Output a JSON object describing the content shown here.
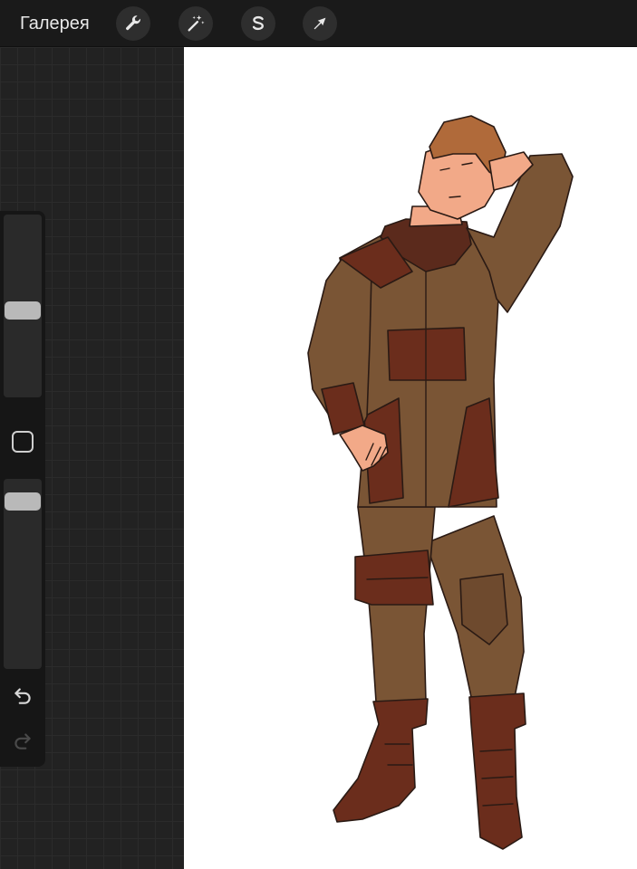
{
  "topbar": {
    "gallery_label": "Галерея",
    "tools": [
      {
        "name": "wrench-icon",
        "action": "actions"
      },
      {
        "name": "magic-wand-icon",
        "action": "adjustments"
      },
      {
        "name": "selection-s-icon",
        "action": "selection"
      },
      {
        "name": "arrow-cursor-icon",
        "action": "transform"
      }
    ]
  },
  "sidebar": {
    "brush_size_level": 0.47,
    "opacity_level": 0.94,
    "modify_button": "square-icon",
    "undo": "undo-icon",
    "redo": "redo-icon",
    "redo_enabled": false
  },
  "canvas": {
    "content": "character-illustration",
    "background": "#ffffff"
  },
  "colors": {
    "toolbar_bg": "#1a1a1a",
    "workspace_bg": "#222222",
    "suit_brown": "#7a5535",
    "suit_dark": "#5b2a1c",
    "skin": "#f2a988",
    "hair": "#b06a3a"
  }
}
